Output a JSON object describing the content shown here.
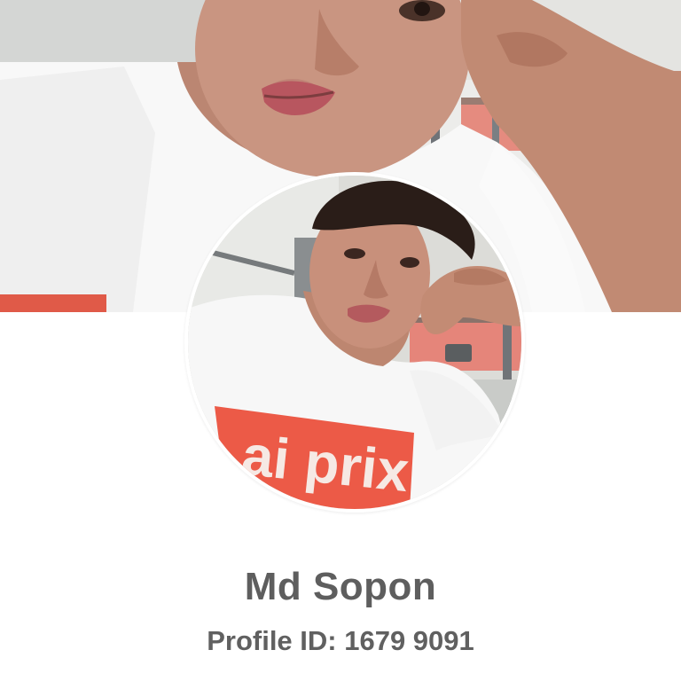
{
  "profile": {
    "name": "Md Sopon",
    "id_label": "Profile ID:",
    "id_value": "1679 9091"
  },
  "images": {
    "cover_icon": "cover-photo-image",
    "avatar_icon": "avatar-photo-image",
    "shirt_text": "ai prix"
  },
  "colors": {
    "name_text": "#5e5e5e",
    "shirt_print": "#ec5a47",
    "shirt": "#f7f7f7",
    "skin": "#c89079"
  }
}
